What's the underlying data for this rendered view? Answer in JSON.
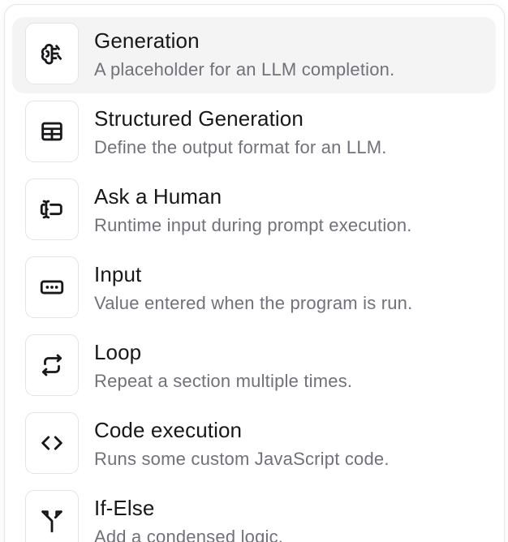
{
  "menu": {
    "items": [
      {
        "icon": "brain-icon",
        "title": "Generation",
        "description": "A placeholder for an LLM completion."
      },
      {
        "icon": "table-icon",
        "title": "Structured Generation",
        "description": "Define the output format for an LLM."
      },
      {
        "icon": "text-cursor-input-icon",
        "title": "Ask a Human",
        "description": "Runtime input during prompt execution."
      },
      {
        "icon": "input-box-icon",
        "title": "Input",
        "description": "Value entered when the program is run."
      },
      {
        "icon": "repeat-icon",
        "title": "Loop",
        "description": "Repeat a section multiple times."
      },
      {
        "icon": "code-icon",
        "title": "Code execution",
        "description": "Runs some custom JavaScript code."
      },
      {
        "icon": "split-icon",
        "title": "If-Else",
        "description": "Add a condensed logic."
      }
    ]
  }
}
